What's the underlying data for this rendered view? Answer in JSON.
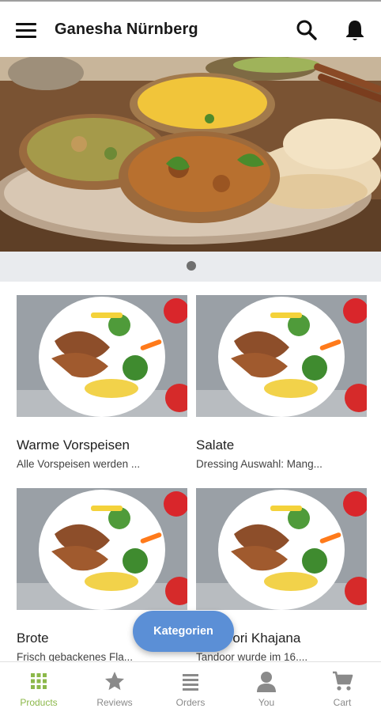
{
  "app": {
    "title": "Ganesha Nürnberg"
  },
  "header": {
    "menu_icon": "menu-icon",
    "search_icon": "search-icon",
    "notification_icon": "bell-icon"
  },
  "hero": {
    "image": "indian-food-platter",
    "slides": 1,
    "active_slide": 1
  },
  "categories": [
    {
      "name": "Warme Vorspeisen",
      "description": "Alle Vorspeisen werden ..."
    },
    {
      "name": "Salate",
      "description": "Dressing Auswahl: Mang..."
    },
    {
      "name": "Brote",
      "description": "Frisch gebackenes Fla..."
    },
    {
      "name": "Tandoori Khajana",
      "description": "Tandoor wurde im 16...."
    }
  ],
  "fab": {
    "label": "Kategorien"
  },
  "bottom_nav": [
    {
      "label": "Products",
      "icon": "grid-icon",
      "active": true
    },
    {
      "label": "Reviews",
      "icon": "star-icon",
      "active": false
    },
    {
      "label": "Orders",
      "icon": "list-icon",
      "active": false
    },
    {
      "label": "You",
      "icon": "person-icon",
      "active": false
    },
    {
      "label": "Cart",
      "icon": "cart-icon",
      "active": false
    }
  ],
  "colors": {
    "accent_active": "#8cb84a",
    "fab": "#5b8fd6",
    "nav_inactive": "#8a8a8a"
  }
}
